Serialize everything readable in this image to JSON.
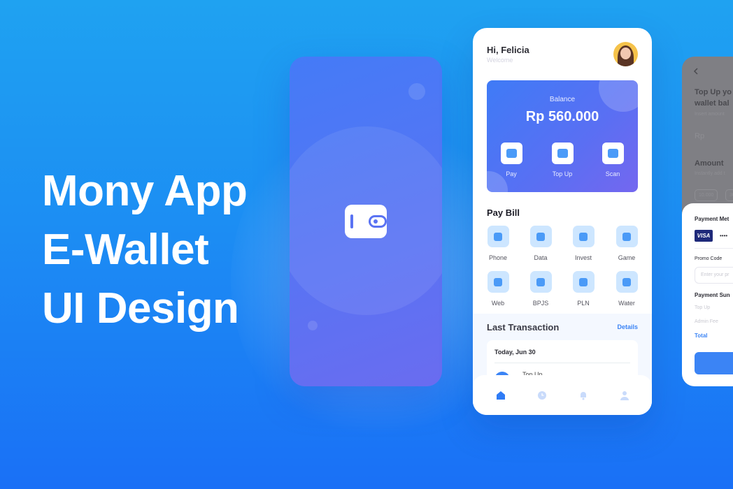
{
  "hero": {
    "line1": "Mony App",
    "line2": "E-Wallet",
    "line3": "UI Design"
  },
  "colors": {
    "accent": "#3b84f5",
    "background_top": "#1fa2f1",
    "background_bottom": "#1a70f6",
    "icon_bg": "#cde6ff"
  },
  "splash": {
    "icon": "wallet-icon"
  },
  "home": {
    "greeting": "Hi, Felicia",
    "subtitle": "Welcome",
    "balance_label": "Balance",
    "balance_value": "Rp 560.000",
    "actions": [
      {
        "label": "Pay",
        "icon": "wallet-icon"
      },
      {
        "label": "Top Up",
        "icon": "top-up-icon"
      },
      {
        "label": "Scan",
        "icon": "scan-icon"
      }
    ],
    "pay_bill_title": "Pay Bill",
    "bills": [
      {
        "label": "Phone",
        "icon": "phone-icon"
      },
      {
        "label": "Data",
        "icon": "wifi-icon"
      },
      {
        "label": "Invest",
        "icon": "invest-icon"
      },
      {
        "label": "Game",
        "icon": "gamepad-icon"
      },
      {
        "label": "Web",
        "icon": "globe-icon"
      },
      {
        "label": "BPJS",
        "icon": "heart-icon"
      },
      {
        "label": "PLN",
        "icon": "bolt-icon"
      },
      {
        "label": "Water",
        "icon": "drop-icon"
      }
    ],
    "last_transaction_title": "Last Transaction",
    "details_link": "Details",
    "transaction_date": "Today, Jun 30",
    "transaction_item": "Top Up",
    "nav": [
      "home-icon",
      "history-icon",
      "bell-icon",
      "profile-icon"
    ]
  },
  "topup": {
    "title_line1": "Top Up yo",
    "title_line2": "wallet bal",
    "hint": "Insert amount",
    "currency": "Rp",
    "amount_title": "Amount",
    "amount_hint": "Instantly add t",
    "chip1": "10.000",
    "chip2": "30",
    "payment_method": "Payment Met",
    "card_brand": "VISA",
    "card_mask": "••••",
    "promo_label": "Promo Code",
    "promo_placeholder": "Enter your pr",
    "summary_title": "Payment Sun",
    "summary_top_up": "Top Up",
    "summary_admin_fee": "Admin Fee",
    "summary_total": "Total"
  }
}
